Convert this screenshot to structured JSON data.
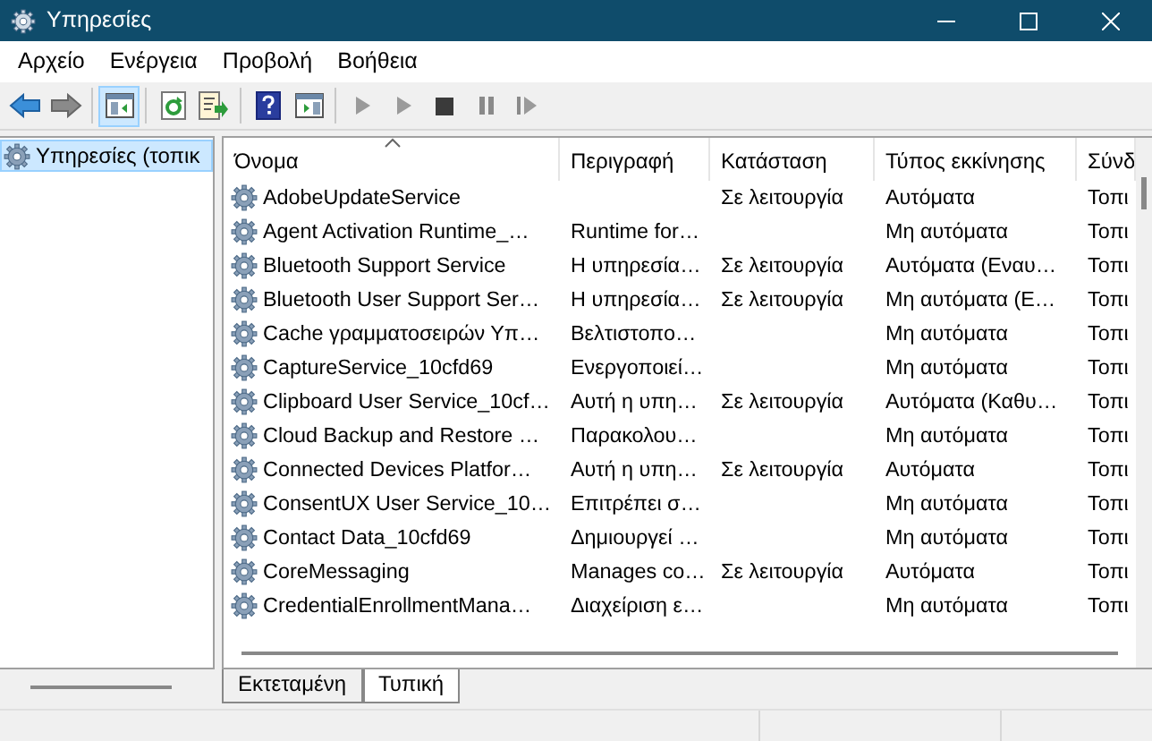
{
  "window": {
    "title": "Υπηρεσίες"
  },
  "menu": [
    "Αρχείο",
    "Ενέργεια",
    "Προβολή",
    "Βοήθεια"
  ],
  "toolbar": [
    {
      "kind": "back",
      "pressed": false
    },
    {
      "kind": "forward",
      "pressed": false
    },
    {
      "kind": "sep"
    },
    {
      "kind": "tree",
      "pressed": true
    },
    {
      "kind": "sep"
    },
    {
      "kind": "refresh",
      "pressed": false
    },
    {
      "kind": "export",
      "pressed": false
    },
    {
      "kind": "sep"
    },
    {
      "kind": "help",
      "pressed": false
    },
    {
      "kind": "view",
      "pressed": false
    },
    {
      "kind": "sep"
    },
    {
      "kind": "play",
      "pressed": false
    },
    {
      "kind": "play",
      "pressed": false
    },
    {
      "kind": "stop",
      "pressed": false
    },
    {
      "kind": "pause",
      "pressed": false
    },
    {
      "kind": "resume",
      "pressed": false
    }
  ],
  "tree": [
    {
      "label": "Υπηρεσίες (τοπικ",
      "selected": true
    }
  ],
  "table": {
    "columns": [
      {
        "label": "Όνομα",
        "sorted": true
      },
      {
        "label": "Περιγραφή",
        "sorted": false
      },
      {
        "label": "Κατάσταση",
        "sorted": false
      },
      {
        "label": "Τύπος εκκίνησης",
        "sorted": false
      },
      {
        "label": "Σύνδ",
        "sorted": false
      }
    ],
    "rows": [
      [
        "AdobeUpdateService",
        "",
        "Σε λειτουργία",
        "Αυτόματα",
        "Τοπι"
      ],
      [
        "Agent Activation Runtime_…",
        "Runtime for…",
        "",
        "Μη αυτόματα",
        "Τοπι"
      ],
      [
        "Bluetooth Support Service",
        "Η υπηρεσία…",
        "Σε λειτουργία",
        "Αυτόματα (Εναυ…",
        "Τοπι"
      ],
      [
        "Bluetooth User Support Ser…",
        "Η υπηρεσία…",
        "Σε λειτουργία",
        "Μη αυτόματα (Ε…",
        "Τοπι"
      ],
      [
        "Cache γραμματοσειρών Υπ…",
        "Βελτιστοπο…",
        "",
        "Μη αυτόματα",
        "Τοπι"
      ],
      [
        "CaptureService_10cfd69",
        "Ενεργοποιεί…",
        "",
        "Μη αυτόματα",
        "Τοπι"
      ],
      [
        "Clipboard User Service_10cf…",
        "Αυτή η υπη…",
        "Σε λειτουργία",
        "Αυτόματα (Καθυ…",
        "Τοπι"
      ],
      [
        "Cloud Backup and Restore …",
        "Παρακολου…",
        "",
        "Μη αυτόματα",
        "Τοπι"
      ],
      [
        "Connected Devices Platfor…",
        "Αυτή η υπη…",
        "Σε λειτουργία",
        "Αυτόματα",
        "Τοπι"
      ],
      [
        "ConsentUX User Service_10…",
        "Επιτρέπει σ…",
        "",
        "Μη αυτόματα",
        "Τοπι"
      ],
      [
        "Contact Data_10cfd69",
        "Δημιουργεί …",
        "",
        "Μη αυτόματα",
        "Τοπι"
      ],
      [
        "CoreMessaging",
        "Manages co…",
        "Σε λειτουργία",
        "Αυτόματα",
        "Τοπι"
      ],
      [
        "CredentialEnrollmentMana…",
        "Διαχείριση ε…",
        "",
        "Μη αυτόματα",
        "Τοπι"
      ]
    ]
  },
  "tabs": [
    {
      "label": "Εκτεταμένη",
      "selected": false
    },
    {
      "label": "Τυπική",
      "selected": true
    }
  ]
}
